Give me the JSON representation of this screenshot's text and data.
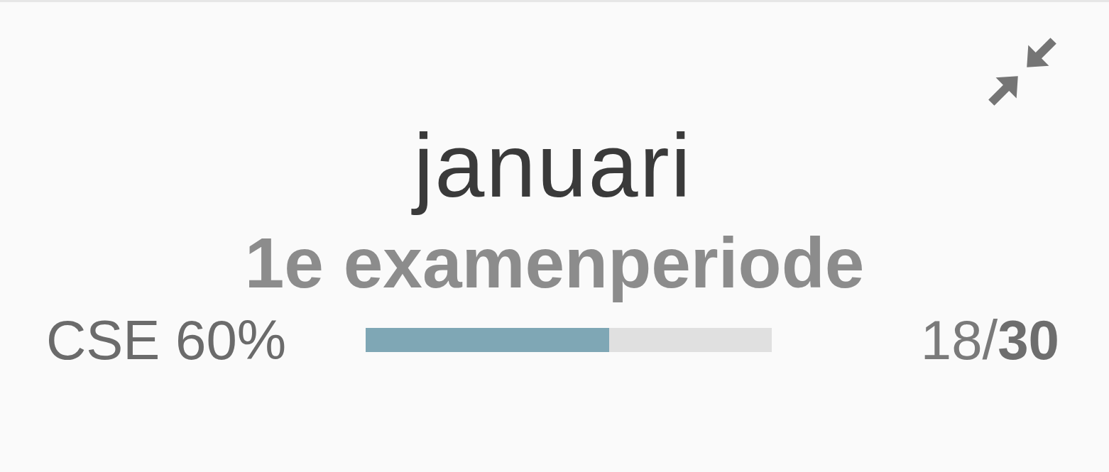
{
  "card": {
    "month": "januari",
    "period": "1e examenperiode",
    "credits_label": "CSE 60%",
    "progress": {
      "level": 0.6
    },
    "credits": "18/**30**"
  }
}
